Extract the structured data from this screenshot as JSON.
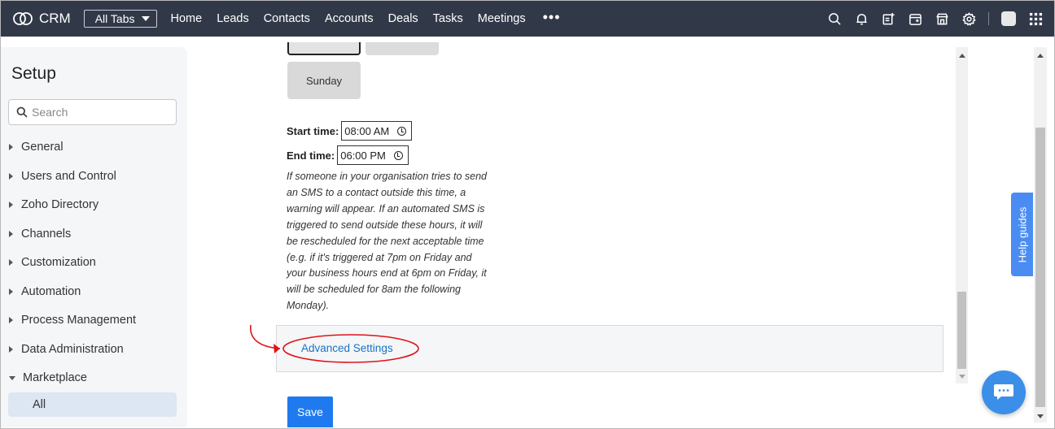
{
  "nav": {
    "brand": "CRM",
    "all_tabs": "All Tabs",
    "links": [
      "Home",
      "Leads",
      "Contacts",
      "Accounts",
      "Deals",
      "Tasks",
      "Meetings"
    ],
    "more": "•••",
    "icons": [
      "search-icon",
      "bell-icon",
      "add-record-icon",
      "calendar-icon",
      "marketplace-icon",
      "settings-icon",
      "avatar",
      "apps-grid-icon"
    ]
  },
  "sidebar": {
    "title": "Setup",
    "search_placeholder": "Search",
    "items": [
      {
        "label": "General"
      },
      {
        "label": "Users and Control"
      },
      {
        "label": "Zoho Directory"
      },
      {
        "label": "Channels"
      },
      {
        "label": "Customization"
      },
      {
        "label": "Automation"
      },
      {
        "label": "Process Management"
      },
      {
        "label": "Data Administration"
      },
      {
        "label": "Marketplace",
        "expanded": true
      }
    ],
    "sub_item": "All"
  },
  "content": {
    "sunday": "Sunday",
    "start_label": "Start time:",
    "start_value": "08:00 AM",
    "end_label": "End time:",
    "end_value": "06:00 PM",
    "note_lines": [
      "If someone in your organisation tries to send",
      "an SMS to a contact outside this time, a",
      "warning will appear. If an automated SMS is",
      "triggered to send outside these hours, it will",
      "be rescheduled for the next acceptable time",
      "(e.g. if it's triggered at 7pm on Friday and",
      "your business hours end at 6pm on Friday, it",
      "will be scheduled for 8am the following",
      "Monday)."
    ],
    "advanced_settings": "Advanced Settings",
    "save": "Save"
  },
  "help_guides": "Help guides",
  "colors": {
    "nav_bg": "#313949",
    "accent": "#1f7aef",
    "link": "#1a73c8",
    "annotation": "#e0121b"
  }
}
